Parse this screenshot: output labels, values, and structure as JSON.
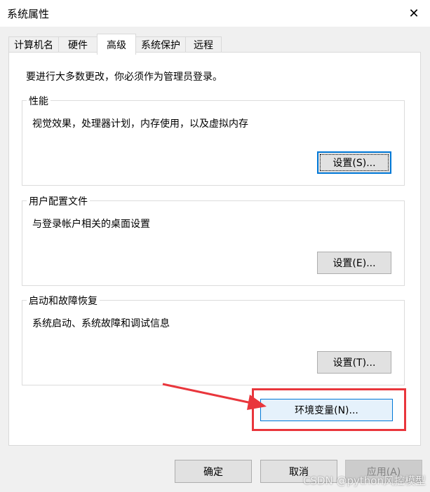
{
  "window": {
    "title": "系统属性",
    "close_glyph": "✕"
  },
  "tabs": [
    {
      "label": "计算机名",
      "active": false
    },
    {
      "label": "硬件",
      "active": false
    },
    {
      "label": "高级",
      "active": true
    },
    {
      "label": "系统保护",
      "active": false
    },
    {
      "label": "远程",
      "active": false
    }
  ],
  "advanced": {
    "intro": "要进行大多数更改，你必须作为管理员登录。",
    "performance": {
      "title": "性能",
      "description": "视觉效果，处理器计划，内存使用，以及虚拟内存",
      "button": "设置(S)..."
    },
    "user_profiles": {
      "title": "用户配置文件",
      "description": "与登录帐户相关的桌面设置",
      "button": "设置(E)..."
    },
    "startup_recovery": {
      "title": "启动和故障恢复",
      "description": "系统启动、系统故障和调试信息",
      "button": "设置(T)..."
    },
    "env_button": "环境变量(N)..."
  },
  "footer": {
    "ok": "确定",
    "cancel": "取消",
    "apply": "应用(A)"
  },
  "watermark": "CSDN @python风控模型",
  "colors": {
    "highlight": "#e9363c",
    "accent": "#0078d7"
  }
}
